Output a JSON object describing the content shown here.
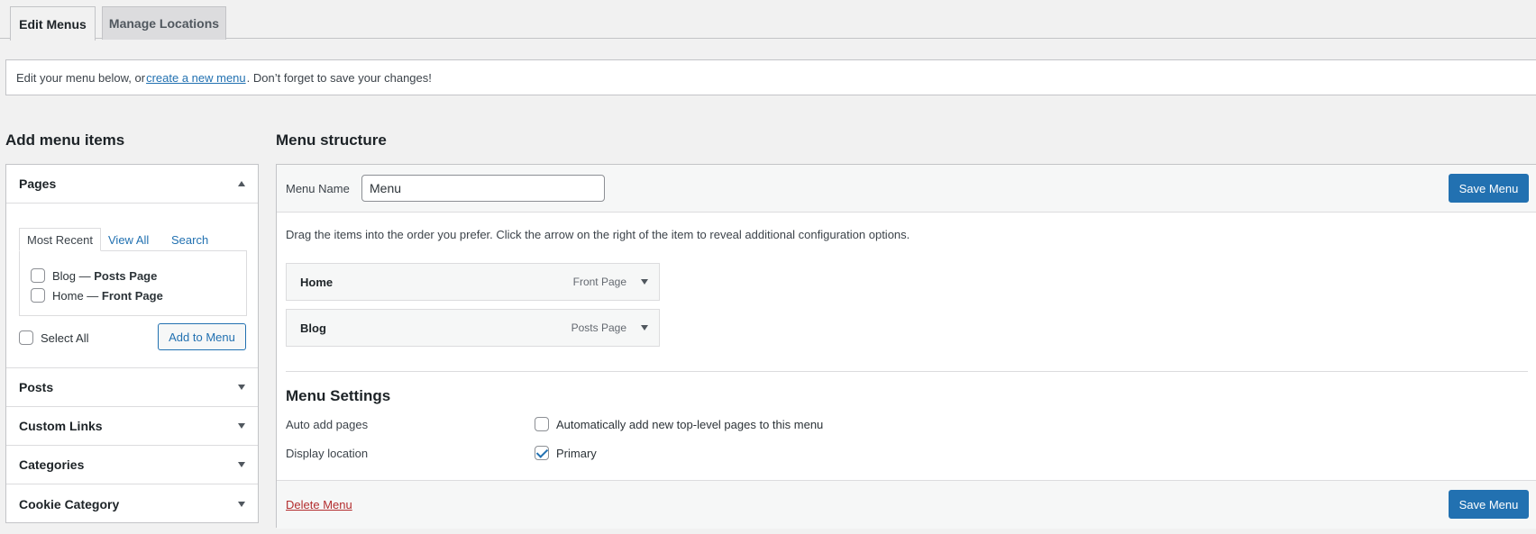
{
  "tabs": [
    {
      "label": "Edit Menus",
      "active": true
    },
    {
      "label": "Manage Locations",
      "active": false
    }
  ],
  "notice": {
    "prefix": "Edit your menu below, or ",
    "link": "create a new menu",
    "suffix": ". Don’t forget to save your changes!"
  },
  "left": {
    "heading": "Add menu items",
    "pages": {
      "title": "Pages",
      "tabs": [
        "Most Recent",
        "View All",
        "Search"
      ],
      "items": [
        {
          "name": "Blog",
          "dash": " — ",
          "type": "Posts Page",
          "checked": false
        },
        {
          "name": "Home",
          "dash": " — ",
          "type": "Front Page",
          "checked": false
        }
      ],
      "select_all": "Select All",
      "add_button": "Add to Menu"
    },
    "sections": [
      "Posts",
      "Custom Links",
      "Categories",
      "Cookie Category"
    ]
  },
  "right": {
    "heading": "Menu structure",
    "menu_name_label": "Menu Name",
    "menu_name_value": "Menu",
    "save_label": "Save Menu",
    "instructions": "Drag the items into the order you prefer. Click the arrow on the right of the item to reveal additional configuration options.",
    "items": [
      {
        "title": "Home",
        "type": "Front Page"
      },
      {
        "title": "Blog",
        "type": "Posts Page"
      }
    ],
    "settings": {
      "title": "Menu Settings",
      "auto_add_label": "Auto add pages",
      "auto_add_text": "Automatically add new top-level pages to this menu",
      "auto_add_checked": false,
      "display_label": "Display location",
      "display_text": "Primary",
      "display_checked": true
    },
    "delete_label": "Delete Menu"
  },
  "colors": {
    "primary": "#2271b1",
    "danger": "#b32d2e",
    "background": "#f1f1f1"
  }
}
